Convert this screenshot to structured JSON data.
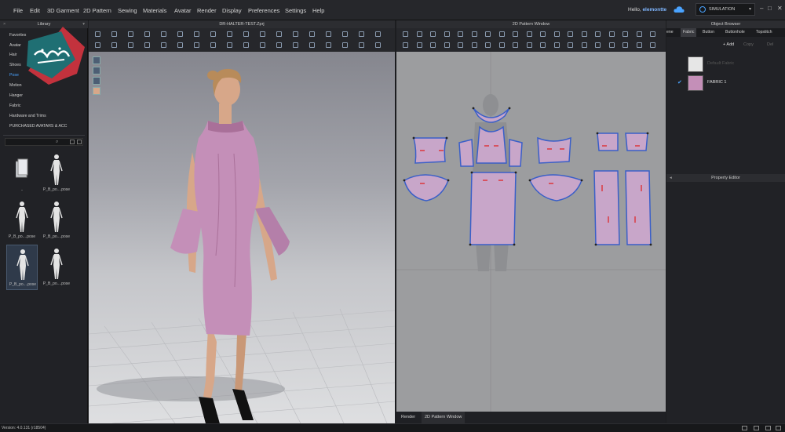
{
  "menu": [
    "File",
    "Edit",
    "3D Garment",
    "2D Pattern",
    "Sewing",
    "Materials",
    "Avatar",
    "Render",
    "Display",
    "Preferences",
    "Settings",
    "Help"
  ],
  "user": {
    "greeting": "Hello,",
    "name": "elemontte"
  },
  "simulation": {
    "label": "SIMULATION"
  },
  "library": {
    "title": "Library",
    "items": [
      "Favorites",
      "Avatar",
      "Hair",
      "Shoes",
      "Pose",
      "Motion",
      "Hanger",
      "Fabric",
      "Hardware and Trims",
      "PURCHASED AVATARS & ACC"
    ],
    "active_index": 4,
    "thumbs": [
      {
        "label": "..",
        "kind": "folder"
      },
      {
        "label": "P_B_po....pose",
        "kind": "figure"
      },
      {
        "label": "P_B_po....pose",
        "kind": "figure"
      },
      {
        "label": "P_B_po....pose",
        "kind": "figure"
      },
      {
        "label": "P_B_po....pose",
        "kind": "figure"
      },
      {
        "label": "P_B_po....pose",
        "kind": "figure"
      }
    ],
    "selected_thumb": 4
  },
  "viewport3d": {
    "title": "DR-HALTER-TEST.Zprj"
  },
  "pattern2d": {
    "title": "2D Pattern Window",
    "tabs": [
      "Render",
      "2D Pattern Window"
    ],
    "active_tab": 1
  },
  "object_browser": {
    "title": "Object Browser",
    "tabs": [
      "ene",
      "Fabric",
      "Button",
      "Buttonhole",
      "Topstitch"
    ],
    "active_tab": 1,
    "add_label": "+ Add",
    "copy_label": "Copy",
    "delete_label": "Del",
    "fabrics": [
      {
        "name": "Default Fabric",
        "color": "#e6e6e6",
        "checked": false,
        "dim": true
      },
      {
        "name": "FABRIC 1",
        "color": "#c48fb8",
        "checked": true,
        "dim": false
      }
    ]
  },
  "property_editor": {
    "title": "Property Editor"
  },
  "status": {
    "version": "Version: 4.0.131 (r18504)"
  },
  "colors": {
    "fabric": "#c48fb8",
    "accent": "#4aa3ff",
    "pattern_fill": "#c8a6c9",
    "seam_blue": "#3a5fc8",
    "seam_red": "#e02020"
  }
}
